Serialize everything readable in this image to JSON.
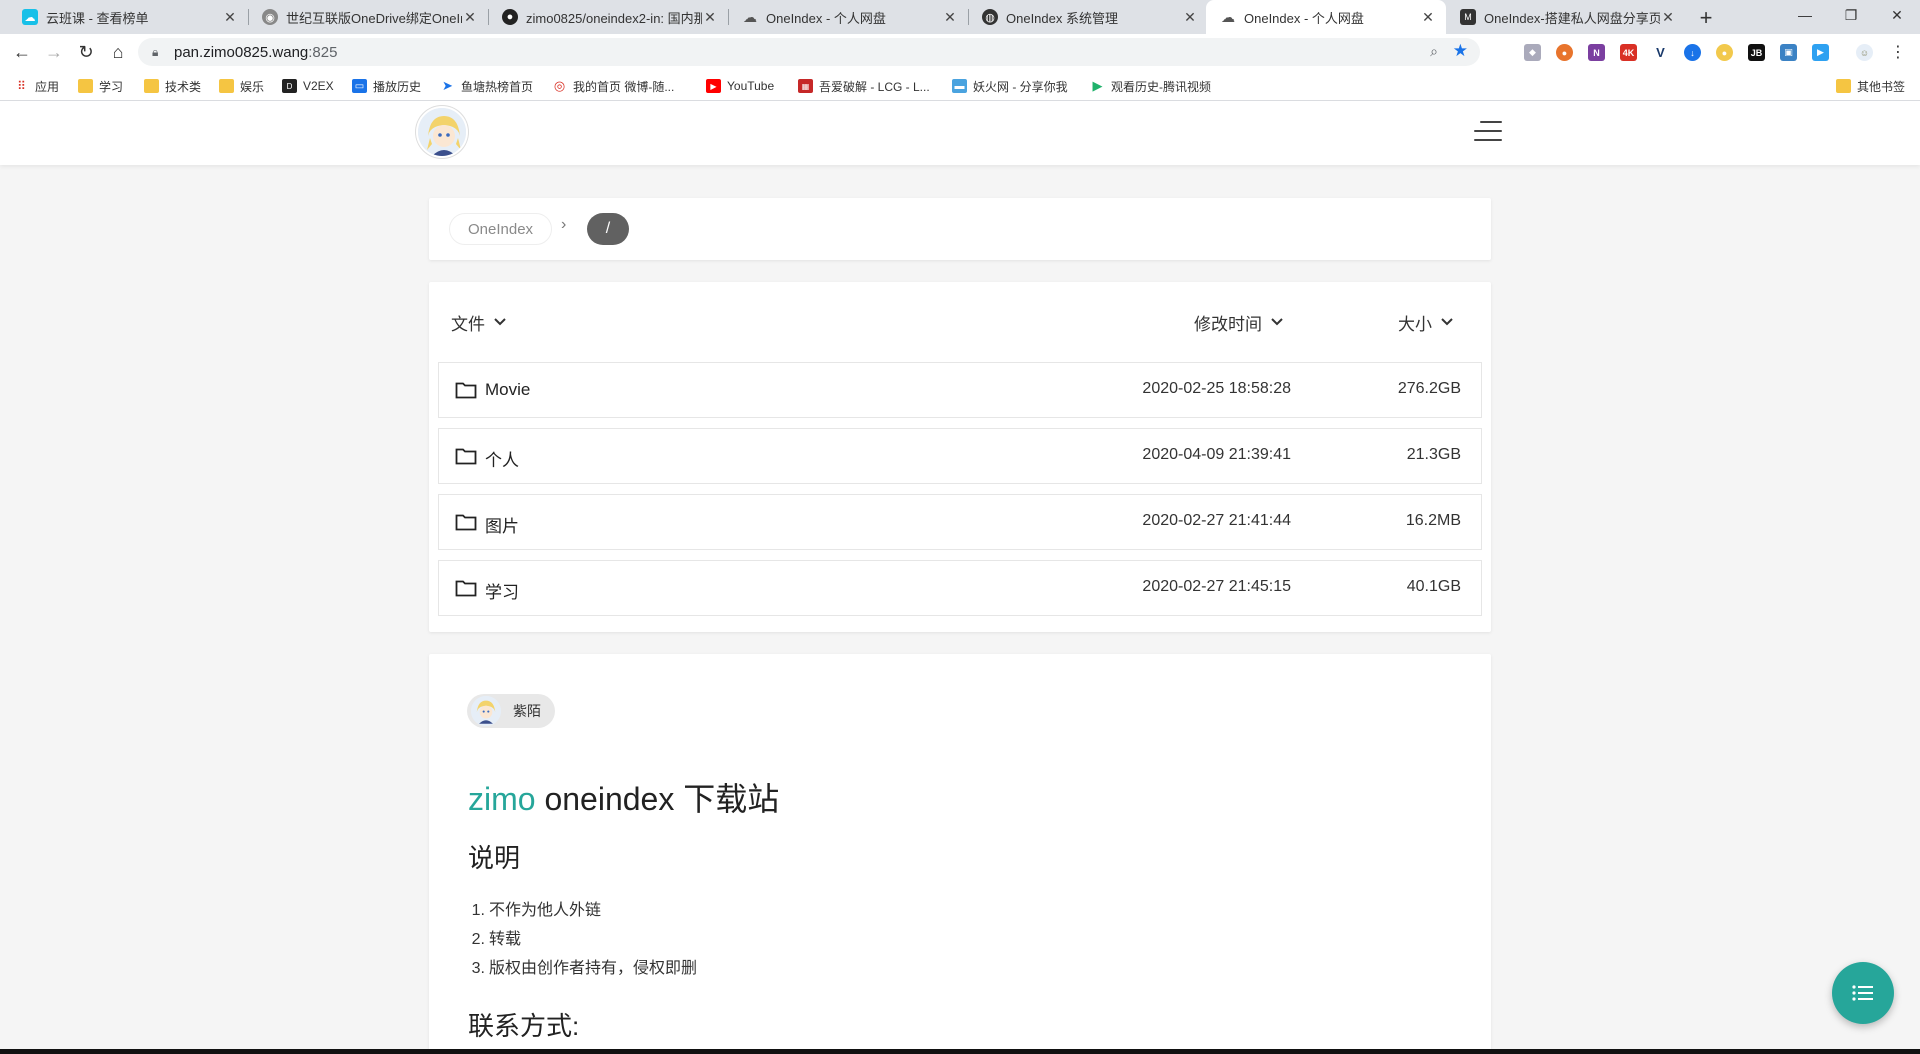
{
  "browser": {
    "tabs": [
      {
        "title": "云班课 - 查看榜单",
        "favicon": "cloud-class-icon"
      },
      {
        "title": "世纪互联版OneDrive绑定OneIn",
        "favicon": "ghost-icon"
      },
      {
        "title": "zimo0825/oneindex2-in: 国内那",
        "favicon": "github-icon"
      },
      {
        "title": "OneIndex - 个人网盘",
        "favicon": "cloud-icon"
      },
      {
        "title": "OneIndex 系统管理",
        "favicon": "globe-icon"
      },
      {
        "title": "OneIndex - 个人网盘",
        "favicon": "cloud-icon",
        "active": true
      },
      {
        "title": "OneIndex-搭建私人网盘分享页",
        "favicon": "blog-icon"
      }
    ],
    "url_host": "pan.zimo0825.wang",
    "url_port": ":825",
    "bookmarks": [
      {
        "label": "应用",
        "icon": "apps-grid-icon"
      },
      {
        "label": "学习",
        "icon": "folder-icon"
      },
      {
        "label": "技术类",
        "icon": "folder-icon"
      },
      {
        "label": "娱乐",
        "icon": "folder-icon"
      },
      {
        "label": "V2EX",
        "icon": "v2ex-icon"
      },
      {
        "label": "播放历史",
        "icon": "tv-icon"
      },
      {
        "label": "鱼塘热榜首页",
        "icon": "fish-icon"
      },
      {
        "label": "我的首页 微博-随...",
        "icon": "weibo-icon"
      },
      {
        "label": "YouTube",
        "icon": "youtube-icon"
      },
      {
        "label": "吾爱破解 - LCG - L...",
        "icon": "52pojie-icon"
      },
      {
        "label": "妖火网 - 分享你我",
        "icon": "chat-bubble-icon"
      },
      {
        "label": "观看历史-腾讯视频",
        "icon": "tencent-video-icon"
      },
      {
        "label": "其他书签",
        "icon": "folder-icon"
      }
    ]
  },
  "breadcrumb": {
    "home": "OneIndex",
    "separator": "›",
    "current": "/"
  },
  "file_list": {
    "headers": {
      "name": "文件",
      "modified": "修改时间",
      "size": "大小"
    },
    "rows": [
      {
        "name": "Movie",
        "modified": "2020-02-25 18:58:28",
        "size": "276.2GB"
      },
      {
        "name": "个人",
        "modified": "2020-04-09 21:39:41",
        "size": "21.3GB"
      },
      {
        "name": "图片",
        "modified": "2020-02-27 21:41:44",
        "size": "16.2MB"
      },
      {
        "name": "学习",
        "modified": "2020-02-27 21:45:15",
        "size": "40.1GB"
      }
    ]
  },
  "readme": {
    "author": "紫陌",
    "title_accent": "zimo",
    "title_rest": " oneindex 下载站",
    "section_notes": "说明",
    "notes": [
      "不作为他人外链",
      "转载",
      "版权由创作者持有，侵权即删"
    ],
    "section_contact": "联系方式:"
  },
  "colors": {
    "accent": "#26a69a",
    "crumb_current_bg": "#616161"
  }
}
